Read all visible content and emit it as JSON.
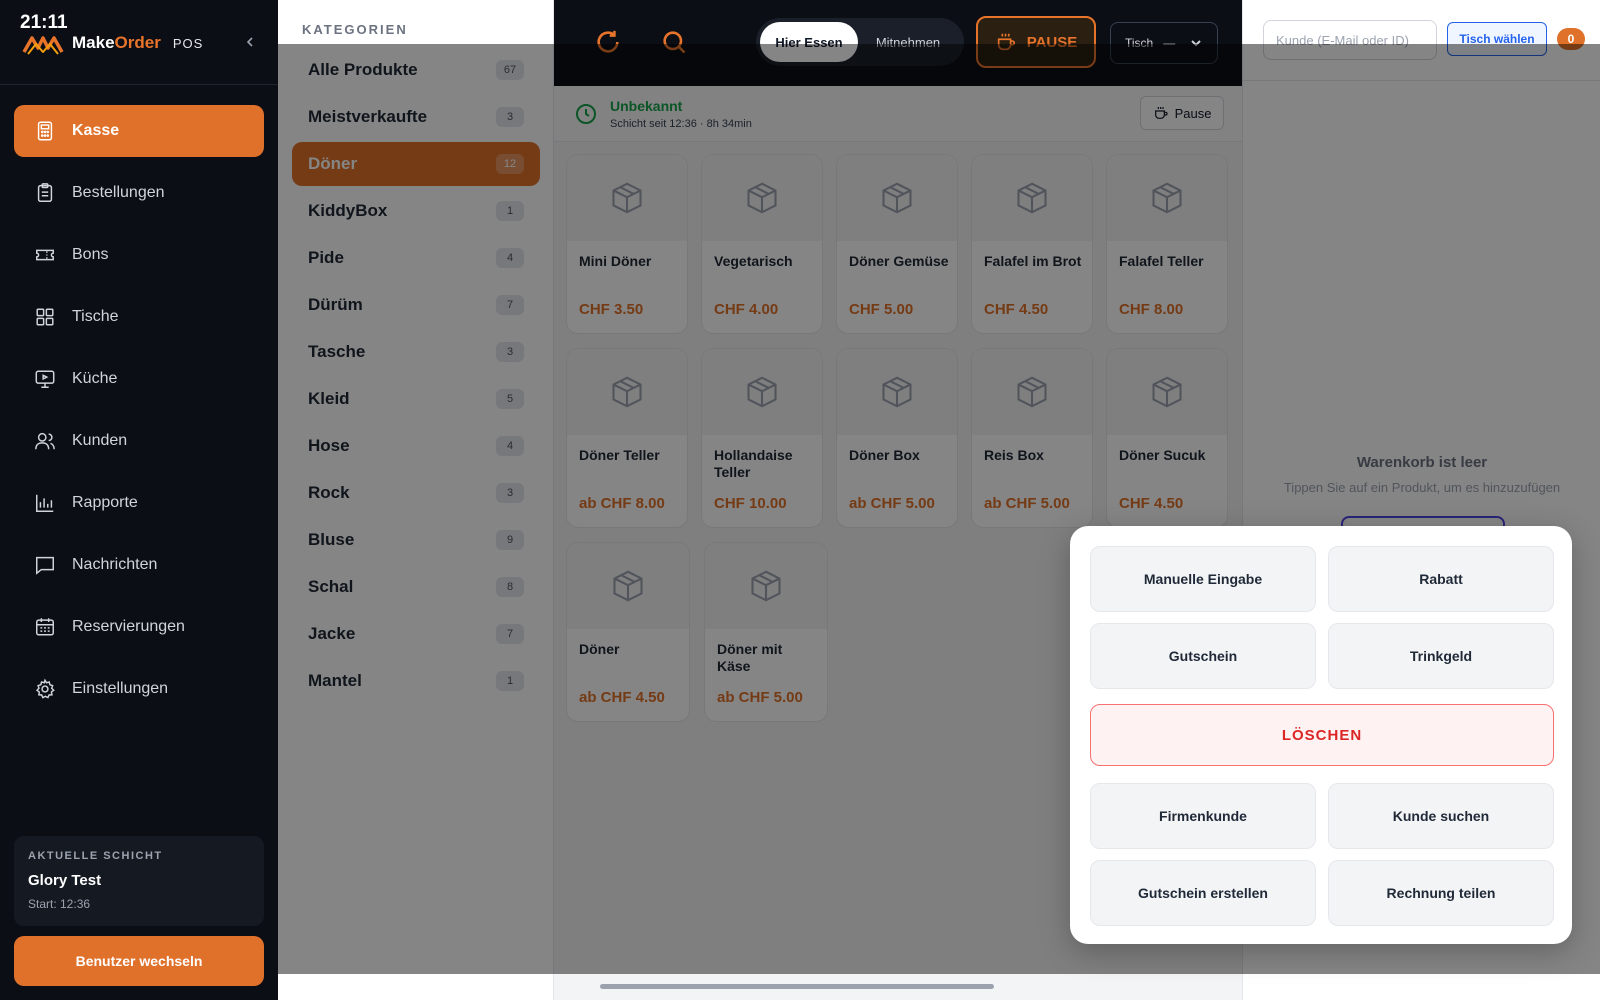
{
  "status": {
    "time": "21:11"
  },
  "brand": {
    "name_part1": "Make",
    "name_part2": "Order",
    "suffix": "POS"
  },
  "sidebar": {
    "items": [
      {
        "label": "Kasse",
        "icon": "calculator-icon",
        "active": true
      },
      {
        "label": "Bestellungen",
        "icon": "clipboard-icon"
      },
      {
        "label": "Bons",
        "icon": "ticket-icon"
      },
      {
        "label": "Tische",
        "icon": "grid-icon"
      },
      {
        "label": "Küche",
        "icon": "monitor-icon"
      },
      {
        "label": "Kunden",
        "icon": "users-icon"
      },
      {
        "label": "Rapporte",
        "icon": "bar-chart-icon"
      },
      {
        "label": "Nachrichten",
        "icon": "message-icon"
      },
      {
        "label": "Reservierungen",
        "icon": "calendar-icon"
      },
      {
        "label": "Einstellungen",
        "icon": "gear-icon"
      }
    ],
    "shift": {
      "label": "AKTUELLE SCHICHT",
      "name": "Glory Test",
      "start": "Start: 12:36"
    },
    "switch_user": "Benutzer wechseln"
  },
  "categories": {
    "heading": "KATEGORIEN",
    "items": [
      {
        "label": "Alle Produkte",
        "count": "67"
      },
      {
        "label": "Meistverkaufte",
        "count": "3"
      },
      {
        "label": "Döner",
        "count": "12",
        "active": true
      },
      {
        "label": "KiddyBox",
        "count": "1"
      },
      {
        "label": "Pide",
        "count": "4"
      },
      {
        "label": "Dürüm",
        "count": "7"
      },
      {
        "label": "Tasche",
        "count": "3"
      },
      {
        "label": "Kleid",
        "count": "5"
      },
      {
        "label": "Hose",
        "count": "4"
      },
      {
        "label": "Rock",
        "count": "3"
      },
      {
        "label": "Bluse",
        "count": "9"
      },
      {
        "label": "Schal",
        "count": "8"
      },
      {
        "label": "Jacke",
        "count": "7"
      },
      {
        "label": "Mantel",
        "count": "1"
      }
    ]
  },
  "topbar": {
    "mode_dine_in": "Hier Essen",
    "mode_takeaway": "Mitnehmen",
    "pause": "PAUSE",
    "table_label": "Tisch",
    "table_value": "—"
  },
  "shift_bar": {
    "status": "Unbekannt",
    "since": "Schicht seit 12:36 · 8h 34min",
    "pause": "Pause"
  },
  "products": [
    {
      "name": "Mini Döner",
      "price": "CHF 3.50"
    },
    {
      "name": "Vegetarisch",
      "price": "CHF 4.00"
    },
    {
      "name": "Döner Gemüse",
      "price": "CHF 5.00"
    },
    {
      "name": "Falafel im Brot",
      "price": "CHF 4.50"
    },
    {
      "name": "Falafel Teller",
      "price": "CHF 8.00"
    },
    {
      "name": "Döner Teller",
      "price": "ab CHF 8.00"
    },
    {
      "name": "Hollandaise Teller",
      "price": "CHF 10.00"
    },
    {
      "name": "Döner Box",
      "price": "ab CHF 5.00"
    },
    {
      "name": "Reis Box",
      "price": "ab CHF 5.00"
    },
    {
      "name": "Döner Sucuk",
      "price": "CHF 4.50"
    },
    {
      "name": "Döner",
      "price": "ab CHF 4.50"
    },
    {
      "name": "Döner mit Käse",
      "price": "ab CHF 5.00"
    }
  ],
  "cart": {
    "customer_placeholder": "Kunde (E-Mail oder ID)",
    "choose_table": "Tisch wählen",
    "count": "0",
    "empty_title": "Warenkorb ist leer",
    "empty_hint": "Tippen Sie auf ein Produkt, um es hinzuzufügen"
  },
  "popup": {
    "manual_entry": "Manuelle Eingabe",
    "discount": "Rabatt",
    "voucher": "Gutschein",
    "tip": "Trinkgeld",
    "delete": "LÖSCHEN",
    "business_customer": "Firmenkunde",
    "search_customer": "Kunde suchen",
    "create_voucher": "Gutschein erstellen",
    "split_bill": "Rechnung teilen"
  },
  "colors": {
    "accent": "#e0712a",
    "sidebar_bg": "#0b0e14",
    "success": "#16a34a",
    "danger": "#dc2626",
    "link": "#2563eb"
  }
}
